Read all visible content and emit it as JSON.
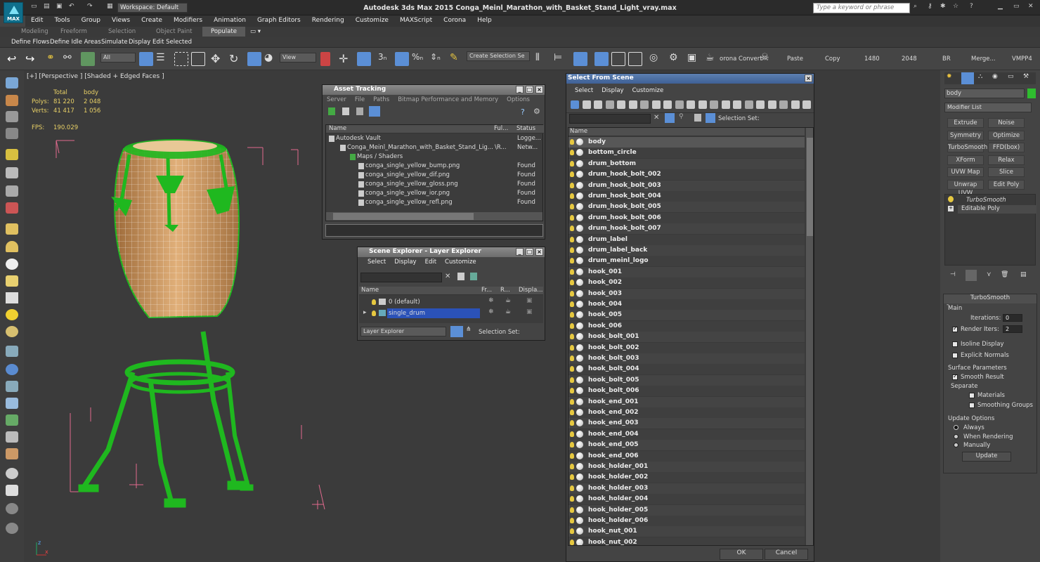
{
  "app": {
    "logo": "MAX",
    "title": "Autodesk 3ds Max  2015     Conga_Meinl_Marathon_with_Basket_Stand_Light_vray.max",
    "workspace": "Workspace: Default",
    "search_placeholder": "Type a keyword or phrase"
  },
  "menu": [
    "Edit",
    "Tools",
    "Group",
    "Views",
    "Create",
    "Modifiers",
    "Animation",
    "Graph Editors",
    "Rendering",
    "Customize",
    "MAXScript",
    "Corona",
    "Help"
  ],
  "ribbon_tabs": [
    "Modeling",
    "Freeform",
    "Selection",
    "Object Paint",
    "Populate"
  ],
  "ribbon_sub": [
    "Define Flows",
    "Define Idle Areas",
    "Simulate",
    "Display",
    "Edit Selected"
  ],
  "toolbar": {
    "filter": "All",
    "ref_coord": "View",
    "sel_set": "Create Selection Se",
    "corona": "orona Convert",
    "texts": [
      "Paste",
      "Copy",
      "1480",
      "2048",
      "BR",
      "Merge...",
      "VMPP4"
    ]
  },
  "viewport": {
    "label": "[+] [Perspective ] [Shaded + Edged Faces ]",
    "stats_head": [
      "Total",
      "body"
    ],
    "polys_label": "Polys:",
    "polys": [
      "81 220",
      "2 048"
    ],
    "verts_label": "Verts:",
    "verts": [
      "41 417",
      "1 056"
    ],
    "fps_label": "FPS:",
    "fps": "190.029"
  },
  "asset_tracking": {
    "title": "Asset Tracking",
    "menu": [
      "Server",
      "File",
      "Paths",
      "Bitmap Performance and Memory",
      "Options"
    ],
    "cols": [
      "Name",
      "Ful...",
      "Status"
    ],
    "rows": [
      {
        "name": "Autodesk Vault",
        "full": "",
        "status": "Logge..."
      },
      {
        "name": "Conga_Meinl_Marathon_with_Basket_Stand_Lig...",
        "full": "\\R...",
        "status": "Netw..."
      },
      {
        "name": "Maps / Shaders",
        "full": "",
        "status": ""
      },
      {
        "name": "conga_single_yellow_bump.png",
        "full": "",
        "status": "Found"
      },
      {
        "name": "conga_single_yellow_dif.png",
        "full": "",
        "status": "Found"
      },
      {
        "name": "conga_single_yellow_gloss.png",
        "full": "",
        "status": "Found"
      },
      {
        "name": "conga_single_yellow_ior.png",
        "full": "",
        "status": "Found"
      },
      {
        "name": "conga_single_yellow_refl.png",
        "full": "",
        "status": "Found"
      }
    ]
  },
  "scene_explorer": {
    "title": "Scene Explorer - Layer Explorer",
    "menu": [
      "Select",
      "Display",
      "Edit",
      "Customize"
    ],
    "cols": [
      "Name",
      "Fr...",
      "R...",
      "Displa..."
    ],
    "rows": [
      "0 (default)",
      "single_drum"
    ],
    "bottom_left": "Layer Explorer",
    "bottom_right": "Selection Set:"
  },
  "select_from_scene": {
    "title": "Select From Scene",
    "menu": [
      "Select",
      "Display",
      "Customize"
    ],
    "selection_set": "Selection Set:",
    "col_name": "Name",
    "items": [
      "body",
      "bottom_circle",
      "drum_bottom",
      "drum_hook_bolt_002",
      "drum_hook_bolt_003",
      "drum_hook_bolt_004",
      "drum_hook_bolt_005",
      "drum_hook_bolt_006",
      "drum_hook_bolt_007",
      "drum_label",
      "drum_label_back",
      "drum_meinl_logo",
      "hook_001",
      "hook_002",
      "hook_003",
      "hook_004",
      "hook_005",
      "hook_006",
      "hook_bolt_001",
      "hook_bolt_002",
      "hook_bolt_003",
      "hook_bolt_004",
      "hook_bolt_005",
      "hook_bolt_006",
      "hook_end_001",
      "hook_end_002",
      "hook_end_003",
      "hook_end_004",
      "hook_end_005",
      "hook_end_006",
      "hook_holder_001",
      "hook_holder_002",
      "hook_holder_003",
      "hook_holder_004",
      "hook_holder_005",
      "hook_holder_006",
      "hook_nut_001",
      "hook_nut_002"
    ],
    "ok": "OK",
    "cancel": "Cancel"
  },
  "command_panel": {
    "object_name": "body",
    "modifier_list": "Modifier List",
    "buttons": [
      "Extrude",
      "Noise",
      "Symmetry",
      "Optimize",
      "TurboSmooth",
      "FFD(box)",
      "XForm",
      "Relax",
      "UVW Map",
      "Slice",
      "Unwrap UVW",
      "Edit Poly"
    ],
    "stack": [
      "TurboSmooth",
      "Editable Poly"
    ],
    "rollout": {
      "title": "TurboSmooth",
      "main": "Main",
      "iterations_label": "Iterations:",
      "iterations": "0",
      "render_iters_label": "Render Iters:",
      "render_iters": "2",
      "isoline": "Isoline Display",
      "explicit": "Explicit Normals",
      "surface": "Surface Parameters",
      "smooth": "Smooth Result",
      "separate": "Separate",
      "materials": "Materials",
      "smoothing": "Smoothing Groups",
      "update_opts": "Update Options",
      "always": "Always",
      "when_rendering": "When Rendering",
      "manually": "Manually",
      "update": "Update"
    }
  },
  "colors": {
    "wire": "#1fb81f",
    "wood": "#d9a66c",
    "bbox": "#e06a8e",
    "selected": "#2b52b8"
  }
}
